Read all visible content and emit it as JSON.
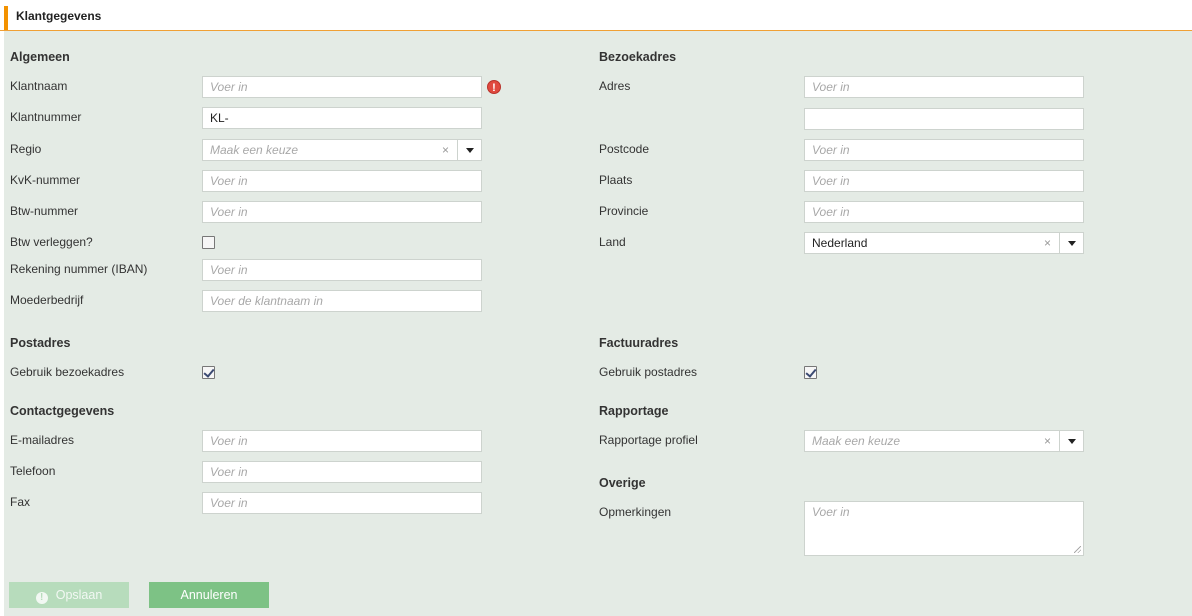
{
  "header": {
    "title": "Klantgegevens"
  },
  "left": {
    "algemeen": {
      "title": "Algemeen",
      "klantnaam": {
        "label": "Klantnaam",
        "placeholder": "Voer in"
      },
      "klantnummer": {
        "label": "Klantnummer",
        "value": "KL-"
      },
      "regio": {
        "label": "Regio",
        "placeholder": "Maak een keuze"
      },
      "kvk": {
        "label": "KvK-nummer",
        "placeholder": "Voer in"
      },
      "btw": {
        "label": "Btw-nummer",
        "placeholder": "Voer in"
      },
      "btw_verleggen": {
        "label": "Btw verleggen?",
        "checked": false
      },
      "iban": {
        "label": "Rekening nummer (IBAN)",
        "placeholder": "Voer in"
      },
      "moederbedrijf": {
        "label": "Moederbedrijf",
        "placeholder": "Voer de klantnaam in"
      }
    },
    "postadres": {
      "title": "Postadres",
      "gebruik_bezoekadres": {
        "label": "Gebruik bezoekadres",
        "checked": true
      }
    },
    "contact": {
      "title": "Contactgegevens",
      "email": {
        "label": "E-mailadres",
        "placeholder": "Voer in"
      },
      "telefoon": {
        "label": "Telefoon",
        "placeholder": "Voer in"
      },
      "fax": {
        "label": "Fax",
        "placeholder": "Voer in"
      }
    }
  },
  "right": {
    "bezoekadres": {
      "title": "Bezoekadres",
      "adres": {
        "label": "Adres",
        "placeholder": "Voer in"
      },
      "postcode": {
        "label": "Postcode",
        "placeholder": "Voer in"
      },
      "plaats": {
        "label": "Plaats",
        "placeholder": "Voer in"
      },
      "provincie": {
        "label": "Provincie",
        "placeholder": "Voer in"
      },
      "land": {
        "label": "Land",
        "value": "Nederland"
      }
    },
    "factuuradres": {
      "title": "Factuuradres",
      "gebruik_postadres": {
        "label": "Gebruik postadres",
        "checked": true
      }
    },
    "rapportage": {
      "title": "Rapportage",
      "profiel": {
        "label": "Rapportage profiel",
        "placeholder": "Maak een keuze"
      }
    },
    "overige": {
      "title": "Overige",
      "opmerkingen": {
        "label": "Opmerkingen",
        "placeholder": "Voer in"
      }
    }
  },
  "actions": {
    "save_label": "Opslaan",
    "cancel_label": "Annuleren"
  },
  "icons": {
    "clear": "×",
    "error": "!"
  },
  "colors": {
    "accent": "#f39200",
    "panel_bg": "#e4ebe5",
    "save_button": "#b7dcbc",
    "cancel_button": "#7dc285",
    "error": "#e04a3f"
  }
}
